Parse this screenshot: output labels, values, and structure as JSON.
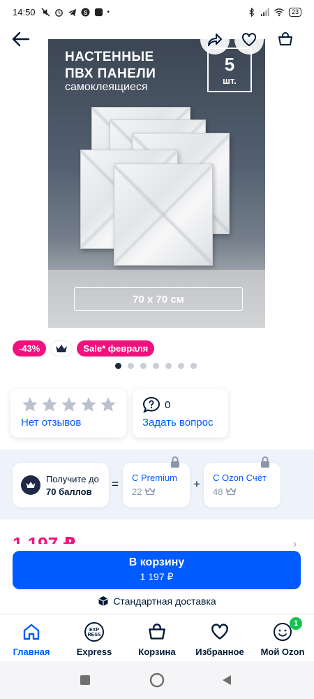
{
  "status_bar": {
    "time": "14:50",
    "battery": "23"
  },
  "product_image": {
    "title_line1": "НАСТЕННЫЕ",
    "title_line2": "ПВХ ПАНЕЛИ",
    "subtitle": "самоклеящиеся",
    "count_number": "5",
    "count_unit": "шт.",
    "size": "70 x 70 см"
  },
  "badges": {
    "discount": "-43%",
    "sale": "Sale* февраля"
  },
  "gallery": {
    "total_dots": 7,
    "active_index": 0
  },
  "reviews": {
    "stars_filled": 0,
    "stars_total": 5,
    "label": "Нет отзывов"
  },
  "questions": {
    "count": "0",
    "label": "Задать вопрос"
  },
  "bonus": {
    "line1": "Получите до",
    "line2": "70 баллов",
    "equals": "=",
    "plus": "+",
    "premium_title": "С Premium",
    "premium_value": "22",
    "ozon_title": "С Ozon Счёт",
    "ozon_value": "48"
  },
  "price_peek": "1 197 ₽",
  "cart_button": {
    "label": "В корзину",
    "price": "1 197 ₽"
  },
  "delivery": {
    "label": "Стандартная доставка"
  },
  "tabbar": {
    "home": "Главная",
    "express": "Express",
    "express_logo_top": "EXP",
    "express_logo_bottom": "RESS",
    "cart": "Корзина",
    "favorites": "Избранное",
    "profile": "Мой Ozon",
    "profile_badge": "1"
  },
  "colors": {
    "accent": "#005bff",
    "sale": "#f1117e",
    "badge_green": "#10c44c"
  }
}
